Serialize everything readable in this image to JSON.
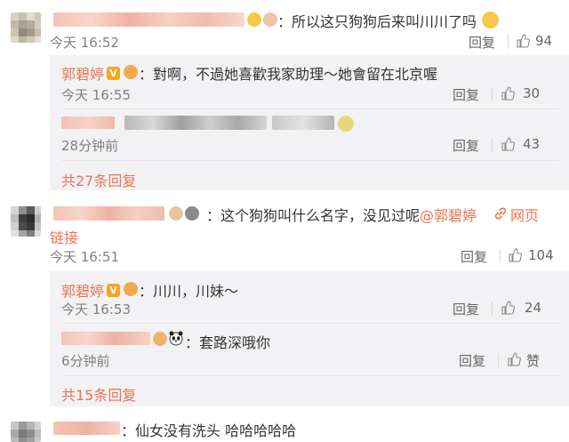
{
  "comments": [
    {
      "text": "：所以这只狗狗后来叫川川了吗",
      "time": "今天 16:52",
      "reply_label": "回复",
      "likes": "94"
    },
    {
      "text": "：这个狗狗叫什么名字，没见过呢",
      "mention": "@郭碧婷",
      "link_label": "网页",
      "link_label2": "链接",
      "time": "今天 16:51",
      "reply_label": "回复",
      "likes": "104"
    },
    {
      "text": "：仙女没有洗头 哈哈哈哈哈"
    }
  ],
  "replies_1": [
    {
      "name": "郭碧婷",
      "text": "：對啊，不過她喜歡我家助理～她會留在北京喔",
      "time": "今天 16:55",
      "reply_label": "回复",
      "likes": "30"
    },
    {
      "text": "",
      "time": "28分钟前",
      "reply_label": "回复",
      "likes": "43"
    }
  ],
  "more_1": "共27条回复",
  "replies_2": [
    {
      "name": "郭碧婷",
      "text": "：川川，川妹～",
      "time": "今天 16:53",
      "reply_label": "回复",
      "likes": "24"
    },
    {
      "text": "：套路深哦你",
      "time": "6分钟前",
      "reply_label": "回复",
      "likes": "赞"
    }
  ],
  "more_2": "共15条回复",
  "colors": {
    "accent": "#eb7350",
    "reply_bg": "#f2f2f5",
    "meta_gray": "#808080"
  },
  "icons": [
    "thumb-up-icon",
    "link-icon",
    "verified-badge-icon",
    "emoji-icon",
    "panda-emoji-icon"
  ]
}
